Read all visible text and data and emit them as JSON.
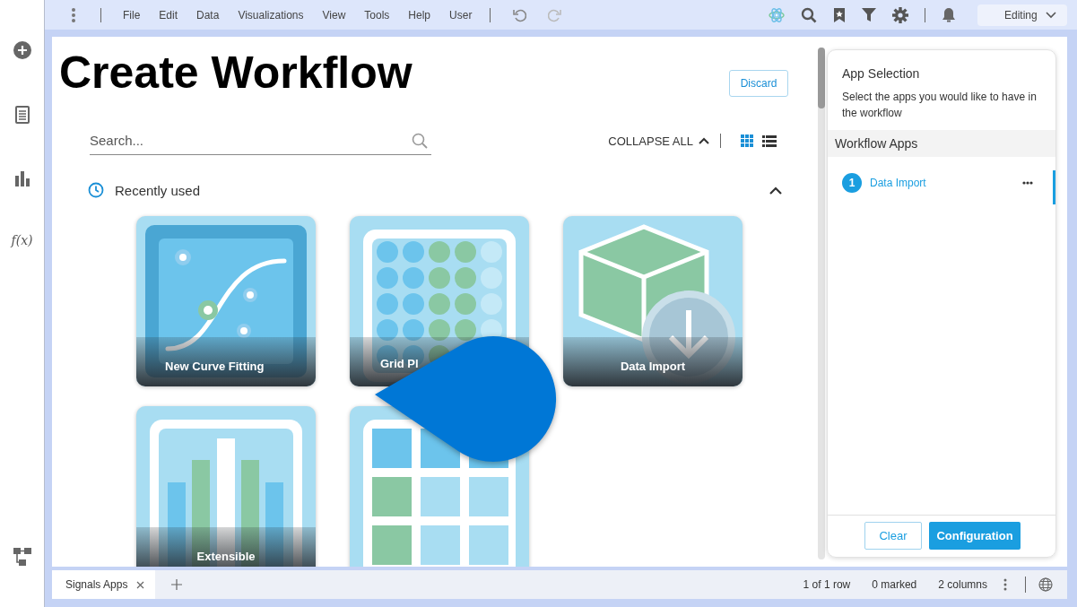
{
  "rail": {
    "function_label": "f(x)"
  },
  "menu_bar": {
    "items": [
      "File",
      "Edit",
      "Data",
      "Visualizations",
      "View",
      "Tools",
      "Help",
      "User"
    ],
    "mode": "Editing"
  },
  "page": {
    "title": "Create Workflow",
    "discard": "Discard",
    "search": {
      "placeholder": "Search..."
    },
    "collapse_all": "COLLAPSE ALL",
    "view_modes": [
      {
        "kind": "grid",
        "selected": true
      },
      {
        "kind": "list",
        "selected": false
      }
    ],
    "section": {
      "title": "Recently used",
      "expanded": true
    },
    "apps": [
      {
        "name": "New Curve Fitting",
        "kind": "curve"
      },
      {
        "name": "Grid Pl",
        "kind": "grid"
      },
      {
        "name": "Data Import",
        "kind": "import"
      },
      {
        "name": "Extensible",
        "kind": "bars"
      },
      {
        "kind": "table"
      }
    ]
  },
  "side_panel": {
    "title": "App Selection",
    "description": "Select the apps you would like to have in the workflow",
    "list_title": "Workflow Apps",
    "apps": [
      {
        "number": "1",
        "name": "Data Import",
        "selected": true
      }
    ],
    "clear": "Clear",
    "configure": "Configuration"
  },
  "status_bar": {
    "tab": "Signals Apps",
    "rows": "1 of 1 row",
    "marked": "0 marked",
    "columns": "2 columns"
  }
}
